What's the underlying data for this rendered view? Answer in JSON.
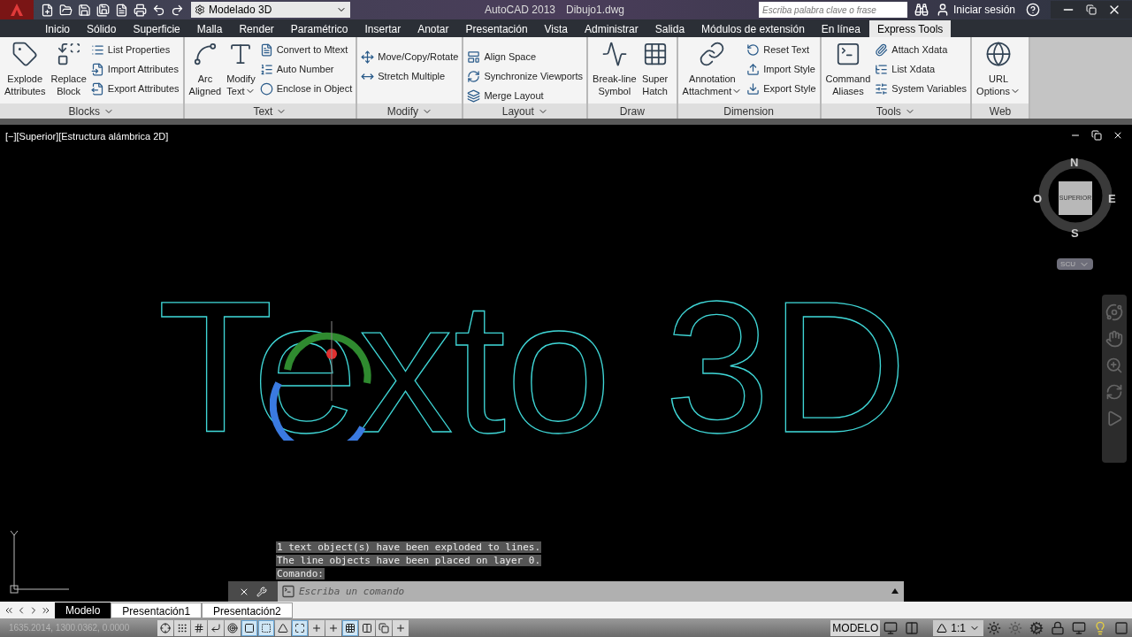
{
  "app_title": "AutoCAD 2013",
  "file_name": "Dibujo1.dwg",
  "workspace": "Modelado 3D",
  "search": {
    "placeholder": "Escriba palabra clave o frase"
  },
  "sign_in": "Iniciar sesión",
  "tabs": [
    {
      "label": "Inicio",
      "selected": false
    },
    {
      "label": "Sólido",
      "selected": false
    },
    {
      "label": "Superficie",
      "selected": false
    },
    {
      "label": "Malla",
      "selected": false
    },
    {
      "label": "Render",
      "selected": false
    },
    {
      "label": "Paramétrico",
      "selected": false
    },
    {
      "label": "Insertar",
      "selected": false
    },
    {
      "label": "Anotar",
      "selected": false
    },
    {
      "label": "Presentación",
      "selected": false
    },
    {
      "label": "Vista",
      "selected": false
    },
    {
      "label": "Administrar",
      "selected": false
    },
    {
      "label": "Salida",
      "selected": false
    },
    {
      "label": "Módulos de extensión",
      "selected": false
    },
    {
      "label": "En línea",
      "selected": false
    },
    {
      "label": "Express Tools",
      "selected": true
    }
  ],
  "ribbon_panels": [
    {
      "title": "Blocks",
      "has_menu": true,
      "large": [
        {
          "lines": [
            "Explode",
            "Attributes"
          ],
          "dropdown": false
        },
        {
          "lines": [
            "Replace",
            "Block"
          ],
          "dropdown": false
        }
      ],
      "small": [
        "List Properties",
        "Import Attributes",
        "Export Attributes"
      ]
    },
    {
      "title": "Text",
      "has_menu": true,
      "large": [
        {
          "lines": [
            "Arc",
            "Aligned"
          ],
          "dropdown": false
        },
        {
          "lines": [
            "Modify",
            "Text"
          ],
          "dropdown": true
        }
      ],
      "small": [
        "Convert to Mtext",
        "Auto Number",
        "Enclose in Object"
      ]
    },
    {
      "title": "Modify",
      "has_menu": true,
      "small": [
        "Move/Copy/Rotate",
        "Stretch Multiple"
      ]
    },
    {
      "title": "Layout",
      "has_menu": true,
      "small": [
        "Align Space",
        "Synchronize Viewports",
        "Merge Layout"
      ]
    },
    {
      "title": "Draw",
      "has_menu": false,
      "large": [
        {
          "lines": [
            "Break-line",
            "Symbol"
          ],
          "dropdown": false
        },
        {
          "lines": [
            "Super",
            "Hatch"
          ],
          "dropdown": false
        }
      ]
    },
    {
      "title": "Dimension",
      "has_menu": false,
      "large": [
        {
          "lines": [
            "Annotation",
            "Attachment"
          ],
          "dropdown": true
        }
      ],
      "small": [
        "Reset Text",
        "Import Style",
        "Export Style"
      ]
    },
    {
      "title": "Tools",
      "has_menu": true,
      "large": [
        {
          "lines": [
            "Command",
            "Aliases"
          ],
          "dropdown": false
        }
      ],
      "small": [
        "Attach Xdata",
        "List Xdata",
        "System Variables"
      ]
    },
    {
      "title": "Web",
      "has_menu": false,
      "large": [
        {
          "lines": [
            "URL",
            "Options"
          ],
          "dropdown": true
        }
      ]
    }
  ],
  "viewport_label": "[−][Superior][Estructura alámbrica 2D]",
  "viewcube": {
    "north": "N",
    "south": "S",
    "east": "E",
    "west": "O",
    "face": "SUPERIOR",
    "ucs": "SCU"
  },
  "canvas_text": "Texto 3D",
  "command_history": [
    "1 text object(s) have been exploded to lines.",
    "The line objects have been placed on layer 0.",
    "Comando:"
  ],
  "command_input": {
    "placeholder": "Escriba un comando"
  },
  "layout_tabs": [
    {
      "label": "Modelo",
      "selected": true
    },
    {
      "label": "Presentación1",
      "selected": false
    },
    {
      "label": "Presentación2",
      "selected": false
    }
  ],
  "coordinates": "1635.2014, 1300.0362, 0.0000",
  "status_toggles": [
    {
      "on": false
    },
    {
      "on": false
    },
    {
      "on": false
    },
    {
      "on": false
    },
    {
      "on": false
    },
    {
      "on": true
    },
    {
      "on": true
    },
    {
      "on": false
    },
    {
      "on": true
    },
    {
      "on": false
    },
    {
      "on": false
    },
    {
      "on": true
    },
    {
      "on": false
    },
    {
      "on": false
    },
    {
      "on": false
    }
  ],
  "space_label": "MODELO",
  "annotation_scale": "1:1"
}
